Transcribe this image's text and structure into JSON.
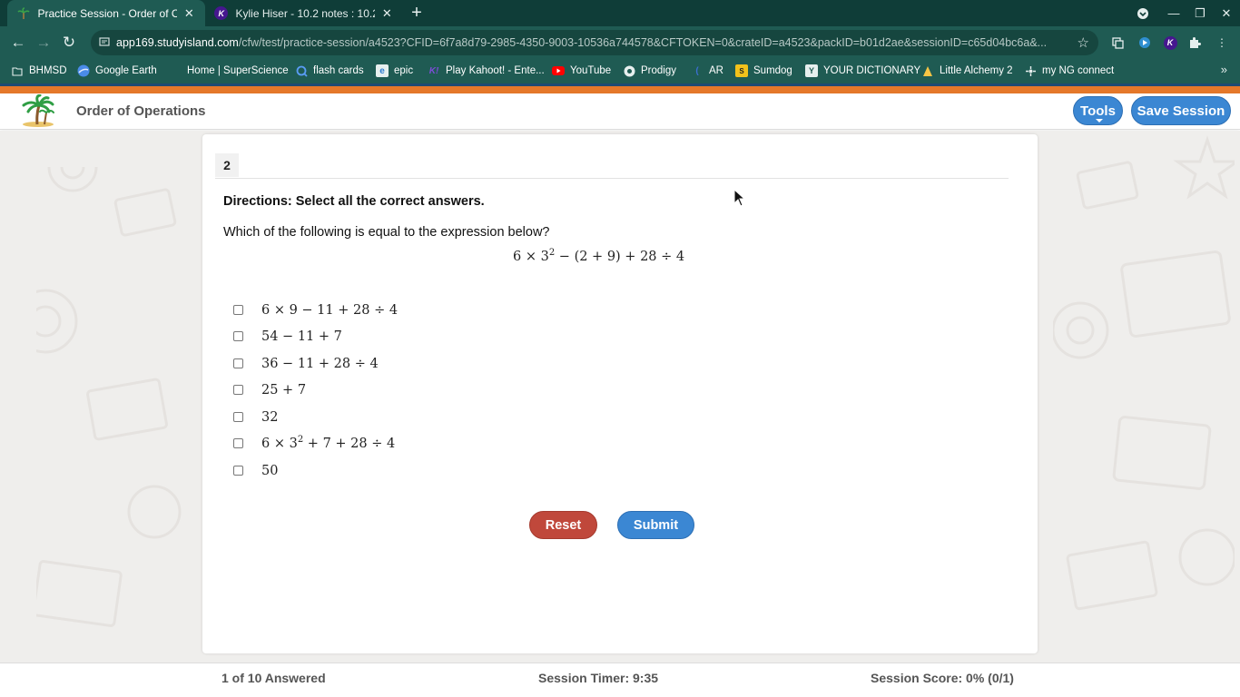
{
  "browser": {
    "tabs": [
      {
        "title": "Practice Session - Order of Opera",
        "active": true
      },
      {
        "title": "Kylie Hiser - 10.2 notes : 10.2 wo",
        "active": false
      }
    ],
    "url": {
      "host": "app169.studyisland.com",
      "path": "/cfw/test/practice-session/a4523?CFID=6f7a8d79-2985-4350-9003-10536a744578&CFTOKEN=0&crateID=a4523&packID=b01d2ae&sessionID=c65d04bc6a&..."
    },
    "bookmarks": [
      {
        "label": "BHMSD",
        "icon": "folder-icon"
      },
      {
        "label": "Google Earth",
        "icon": "google-earth-icon"
      },
      {
        "label": "Home | SuperScience",
        "icon": "blank-icon"
      },
      {
        "label": "flash cards",
        "icon": "quizlet-icon"
      },
      {
        "label": "epic",
        "icon": "epic-icon"
      },
      {
        "label": "Play Kahoot! - Ente...",
        "icon": "kahoot-icon"
      },
      {
        "label": "YouTube",
        "icon": "youtube-icon"
      },
      {
        "label": "Prodigy",
        "icon": "prodigy-icon"
      },
      {
        "label": "AR",
        "icon": "ar-icon"
      },
      {
        "label": "Sumdog",
        "icon": "sumdog-icon"
      },
      {
        "label": "YOUR DICTIONARY",
        "icon": "dictionary-icon"
      },
      {
        "label": "Little Alchemy 2",
        "icon": "alchemy-icon"
      },
      {
        "label": "my NG connect",
        "icon": "ngconnect-icon"
      }
    ]
  },
  "header": {
    "title": "Order of Operations",
    "tools_label": "Tools",
    "save_label": "Save Session"
  },
  "question": {
    "number": "2",
    "directions": "Directions: Select all the correct answers.",
    "prompt": "Which of the following is equal to the expression below?",
    "expression": {
      "pre": "6 × 3",
      "sup": "2",
      "post": " − (2 + 9) + 28 ÷ 4"
    },
    "choices": [
      {
        "pre": "6 × 9 − 11 + 28 ÷ 4",
        "sup": "",
        "post": ""
      },
      {
        "pre": "54 − 11 + 7",
        "sup": "",
        "post": ""
      },
      {
        "pre": "36 − 11 + 28 ÷ 4",
        "sup": "",
        "post": ""
      },
      {
        "pre": "25 + 7",
        "sup": "",
        "post": ""
      },
      {
        "pre": "32",
        "sup": "",
        "post": ""
      },
      {
        "pre": "6 × 3",
        "sup": "2",
        "post": " + 7 + 28 ÷ 4"
      },
      {
        "pre": "50",
        "sup": "",
        "post": ""
      }
    ],
    "reset_label": "Reset",
    "submit_label": "Submit"
  },
  "footer": {
    "answered": "1 of 10 Answered",
    "timer": "Session Timer: 9:35",
    "score": "Session Score: 0% (0/1)"
  },
  "colors": {
    "browser_frame": "#1f5b53",
    "accent_orange": "#e5782a",
    "button_blue": "#3b87d3",
    "button_red": "#c0483b"
  }
}
